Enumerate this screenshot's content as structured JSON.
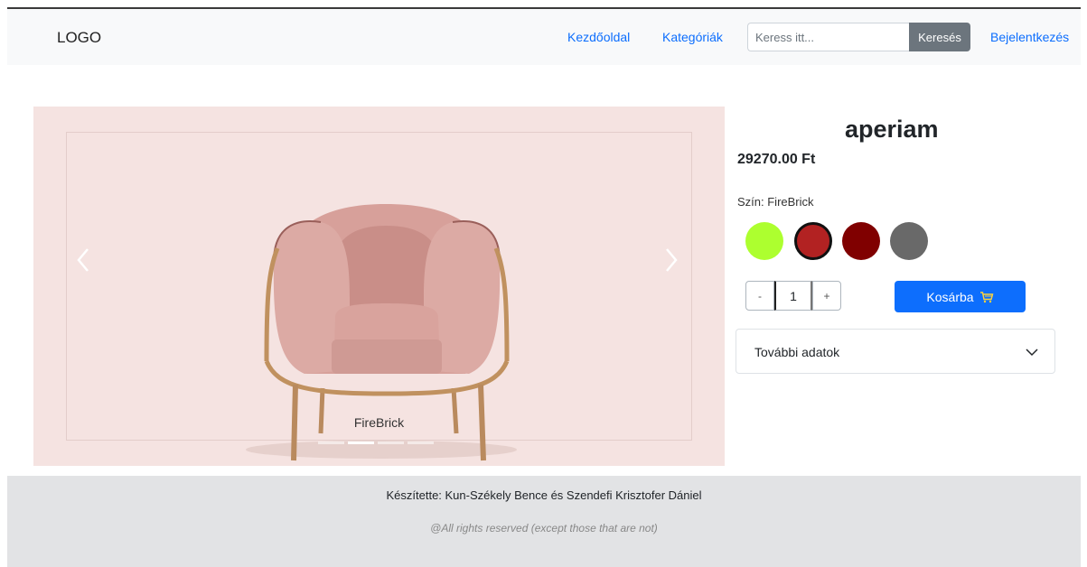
{
  "navbar": {
    "logo": "LOGO",
    "links": [
      "Kezdőoldal",
      "Kategóriák"
    ],
    "search": {
      "placeholder": "Keress itt...",
      "value": "",
      "button_label": "Keresés"
    },
    "login_label": "Bejelentkezés"
  },
  "gallery": {
    "caption": "FireBrick",
    "slide_count": 4,
    "active_slide": 2
  },
  "product": {
    "title": "aperiam",
    "price": "29270.00 Ft",
    "color_label": "Szín: FireBrick",
    "swatches": [
      {
        "name": "GreenYellow",
        "hex": "#adff2f",
        "selected": false
      },
      {
        "name": "FireBrick",
        "hex": "#b22222",
        "selected": true
      },
      {
        "name": "Maroon",
        "hex": "#800000",
        "selected": false
      },
      {
        "name": "DimGray",
        "hex": "#696969",
        "selected": false
      }
    ],
    "quantity": {
      "minus": "-",
      "value": "1",
      "plus": "+"
    },
    "cart_label": "Kosárba",
    "details_label": "További adatok"
  },
  "footer": {
    "credit": "Készítette: Kun-Székely Bence és Szendefi Krisztofer Dániel",
    "rights": "@All rights reserved (except those that are not)"
  },
  "colors": {
    "primary": "#0d6efd",
    "secondary": "#6c757d",
    "gallery_bg": "#f5e3e1",
    "footer_bg": "#e2e3e5"
  }
}
